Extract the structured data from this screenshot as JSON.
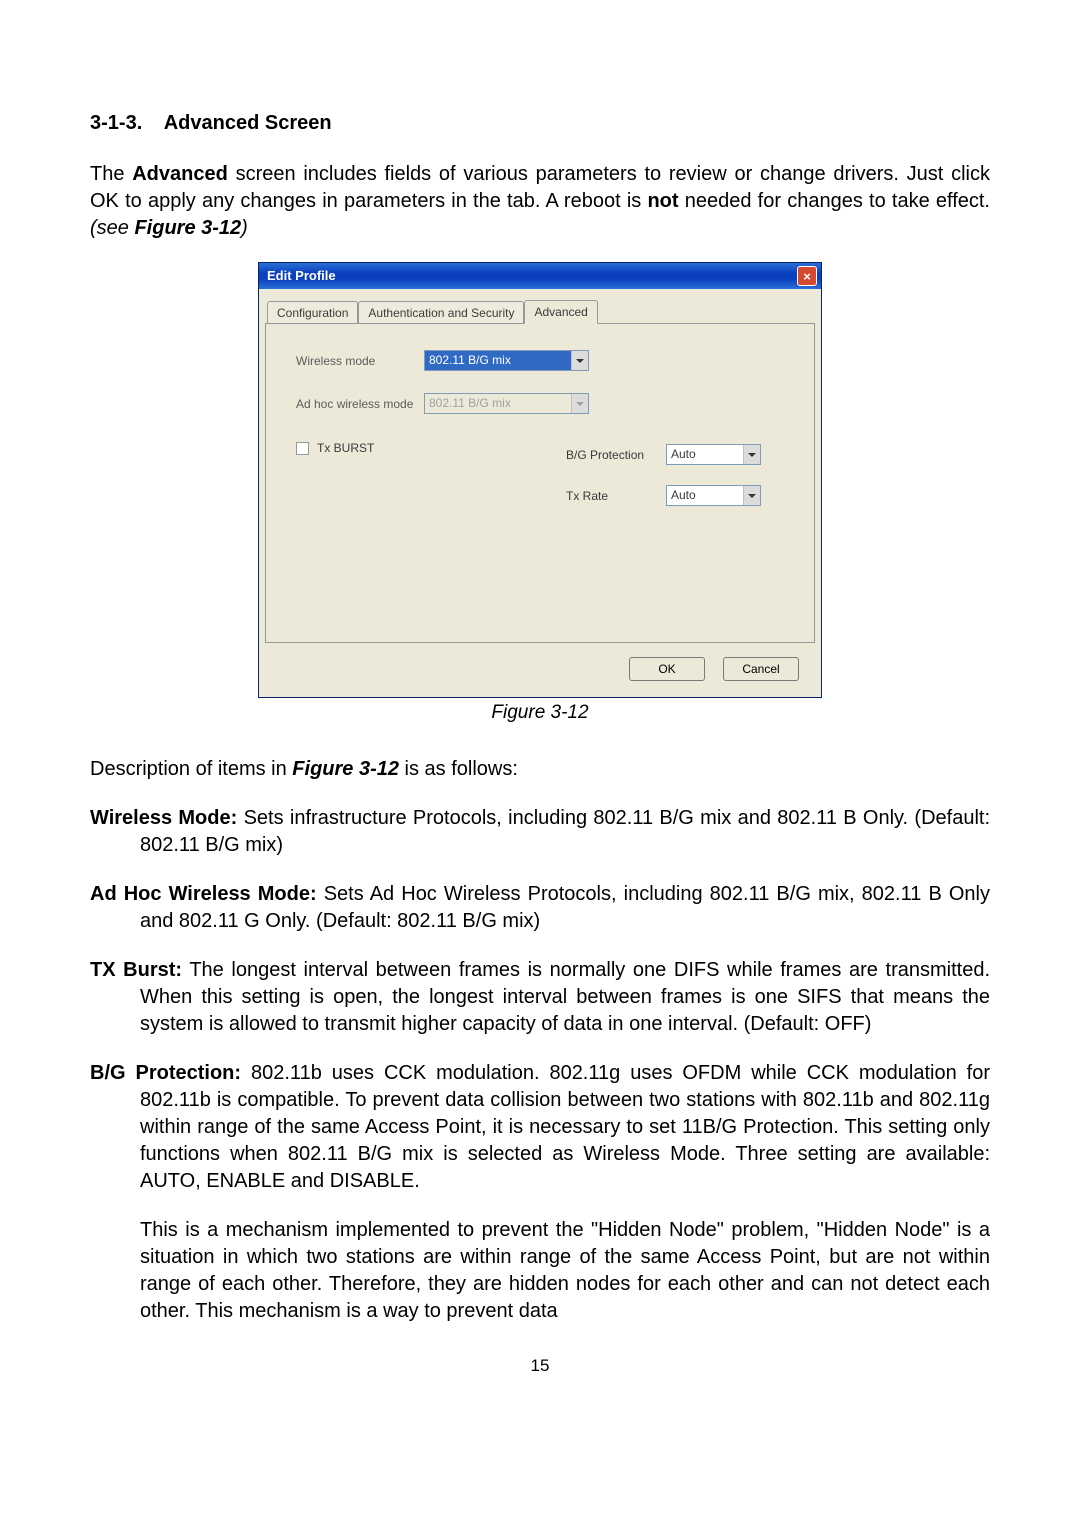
{
  "section": {
    "number": "3-1-3.",
    "title": "Advanced Screen"
  },
  "intro": {
    "pre": "The ",
    "b1": "Advanced",
    "mid": " screen includes fields of various parameters to review or change drivers. Just click OK to apply any changes in parameters in the tab. A reboot is ",
    "b2": "not",
    "post": " needed for changes to take effect. ",
    "see_pre": "(see ",
    "see_fig": "Figure 3-12",
    "see_post": ")"
  },
  "dialog": {
    "title": "Edit Profile",
    "close": "×",
    "tabs": {
      "configuration": "Configuration",
      "authsec": "Authentication and Security",
      "advanced": "Advanced"
    },
    "fields": {
      "wireless_mode": {
        "label": "Wireless mode",
        "value": "802.11 B/G mix"
      },
      "adhoc_mode": {
        "label": "Ad hoc wireless mode",
        "value": "802.11 B/G mix"
      },
      "txburst": {
        "label": "Tx BURST"
      },
      "bg_protection": {
        "label": "B/G Protection",
        "value": "Auto"
      },
      "tx_rate": {
        "label": "Tx Rate",
        "value": "Auto"
      }
    },
    "buttons": {
      "ok": "OK",
      "cancel": "Cancel"
    }
  },
  "figure_caption": "Figure 3-12",
  "desc_lead": {
    "pre": "Description of items in ",
    "fig": "Figure 3-12",
    "post": " is as follows:"
  },
  "items": {
    "wireless_mode": {
      "name": "Wireless Mode:",
      "text": " Sets infrastructure Protocols, including 802.11 B/G mix and 802.11 B Only. (Default: 802.11 B/G mix)"
    },
    "adhoc": {
      "name": "Ad Hoc Wireless Mode:",
      "text": " Sets Ad Hoc Wireless Protocols, including 802.11 B/G mix, 802.11 B Only and 802.11 G Only. (Default: 802.11 B/G mix)"
    },
    "txburst": {
      "name": "TX Burst:",
      "text": " The longest interval between frames is normally one DIFS while frames are transmitted. When this setting is open, the longest interval between frames is one SIFS that means the system is allowed to transmit higher capacity of data in one interval. (Default: OFF)"
    },
    "bgprot": {
      "name": "B/G Protection:",
      "text": " 802.11b uses CCK modulation. 802.11g uses OFDM while CCK modulation for 802.11b is compatible. To prevent data collision between two stations with 802.11b and 802.11g within range of the same Access Point, it is necessary to set 11B/G Protection. This setting only functions when 802.11 B/G mix is selected as Wireless Mode. Three setting are available: AUTO, ENABLE and DISABLE.",
      "text2": "This is a mechanism implemented to prevent the \"Hidden Node\" problem, \"Hidden Node\" is a situation in which two stations are within range of the same Access Point, but are not within range of each other. Therefore, they are hidden nodes for each other and can not detect each other. This mechanism is a way to prevent data"
    }
  },
  "page_number": "15"
}
